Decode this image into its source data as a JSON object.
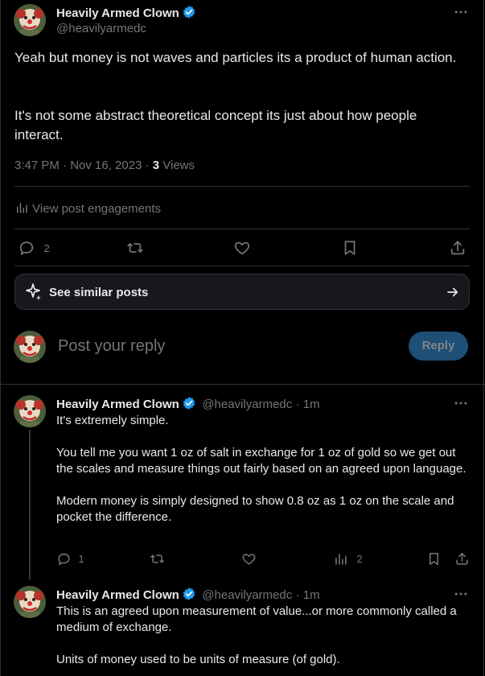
{
  "main_post": {
    "author_name": "Heavily Armed Clown",
    "author_handle": "@heavilyarmedc",
    "paragraph1": "Yeah but money is not waves and particles its a product of human action.",
    "paragraph2": "It's not some abstract theoretical concept its just about how people interact.",
    "time": "3:47 PM · Nov 16, 2023 · ",
    "views_count": "3",
    "views_label": " Views",
    "engagements_label": "View post engagements",
    "reply_count": "2",
    "see_similar": "See similar posts"
  },
  "composer": {
    "placeholder": "Post your reply",
    "reply_button": "Reply"
  },
  "replies": [
    {
      "author_name": "Heavily Armed Clown",
      "author_handle": "@heavilyarmedc",
      "time": "· 1m",
      "text": "It's extremely simple.\n\nYou tell me you want 1 oz of salt in exchange for 1 oz of gold so we get out the scales and measure things out fairly based on an agreed upon language.\n\nModern money is simply designed to show 0.8 oz as 1 oz on the scale and pocket the difference.",
      "reply_count": "1",
      "views_count": "2"
    },
    {
      "author_name": "Heavily Armed Clown",
      "author_handle": "@heavilyarmedc",
      "time": "· 1m",
      "text": "This is an agreed upon measurement of value...or more commonly called a medium of exchange.\n\nUnits of money used to be units of measure (of gold)."
    }
  ],
  "colors": {
    "background": "#000000",
    "text": "#e7e9ea",
    "muted": "#71767b",
    "verified": "#1d9bf0",
    "reply_button": "#1d4f77",
    "divider": "#2f3336"
  },
  "icons": {
    "verified": "verified-badge-icon",
    "more": "more-dots-icon",
    "analytics": "bar-chart-icon",
    "reply": "speech-bubble-icon",
    "repost": "repost-arrows-icon",
    "like": "heart-icon",
    "bookmark": "bookmark-icon",
    "share": "share-upload-icon",
    "sparkle": "sparkle-icon",
    "arrow": "arrow-right-icon"
  }
}
